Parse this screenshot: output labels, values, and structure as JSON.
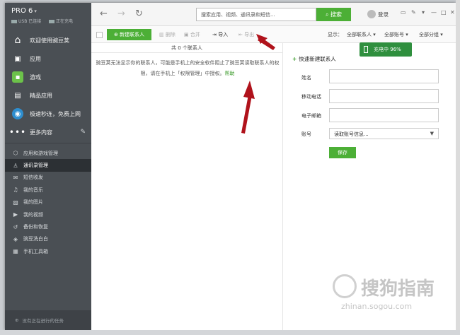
{
  "app": {
    "brand": "PRO 6",
    "status_usb": "USB 已连接",
    "status_charge": "正在充电"
  },
  "sidebar": {
    "main": [
      {
        "label": "欢迎使用豌豆荚",
        "icon": "home-icon",
        "glyph": "⌂"
      },
      {
        "label": "应用",
        "icon": "app-bag-icon",
        "glyph": "▣"
      },
      {
        "label": "游戏",
        "icon": "game-icon",
        "glyph": "▪"
      },
      {
        "label": "精品应用",
        "icon": "gift-icon",
        "glyph": "▤"
      },
      {
        "label": "极速秒连，免费上网",
        "icon": "wifi-icon",
        "glyph": "◉"
      },
      {
        "label": "更多内容",
        "icon": "more-icon",
        "glyph": "•••"
      }
    ],
    "sub": [
      {
        "label": "应用和游戏管理",
        "icon": "cube-icon",
        "glyph": "⬡"
      },
      {
        "label": "通讯录管理",
        "icon": "person-icon",
        "glyph": "👤",
        "active": true
      },
      {
        "label": "短信收发",
        "icon": "sms-icon",
        "glyph": "✉"
      },
      {
        "label": "我的音乐",
        "icon": "music-icon",
        "glyph": "♫"
      },
      {
        "label": "我的图片",
        "icon": "picture-icon",
        "glyph": "▧"
      },
      {
        "label": "我的视频",
        "icon": "video-icon",
        "glyph": "▶"
      },
      {
        "label": "备份和恢复",
        "icon": "backup-icon",
        "glyph": "↺"
      },
      {
        "label": "豌豆洗白白",
        "icon": "clean-icon",
        "glyph": "◈"
      },
      {
        "label": "手机工具箱",
        "icon": "toolbox-icon",
        "glyph": "▦"
      }
    ],
    "tasks": "没有正在进行的任务"
  },
  "topbar": {
    "search_placeholder": "搜索应用、视频、通讯录和短信...",
    "search_button": "搜索",
    "login": "登录"
  },
  "toolbar": {
    "new_contact": "新建联系人",
    "delete": "删除",
    "merge": "合并",
    "import": "导入",
    "export": "导出",
    "display_label": "显示：",
    "filter_contacts": "全部联系人",
    "filter_accounts": "全部账号",
    "filter_groups": "全部分组"
  },
  "list": {
    "count_text": "共 0 个联系人",
    "notice": "豌豆荚无法显示你的联系人，可能是手机上的安全软件阻止了豌豆荚读取联系人的权限，请在手机上「权限管理」中授权。",
    "help": "帮助"
  },
  "form": {
    "title": "快速新建联系人",
    "charge_badge": "充电中 96%",
    "name_label": "姓名",
    "mobile_label": "移动电话",
    "email_label": "电子邮箱",
    "account_label": "账号",
    "account_value": "读取账号信息...",
    "save": "保存"
  },
  "watermark": {
    "text": "搜狗指南",
    "url": "zhinan.sogou.com"
  }
}
